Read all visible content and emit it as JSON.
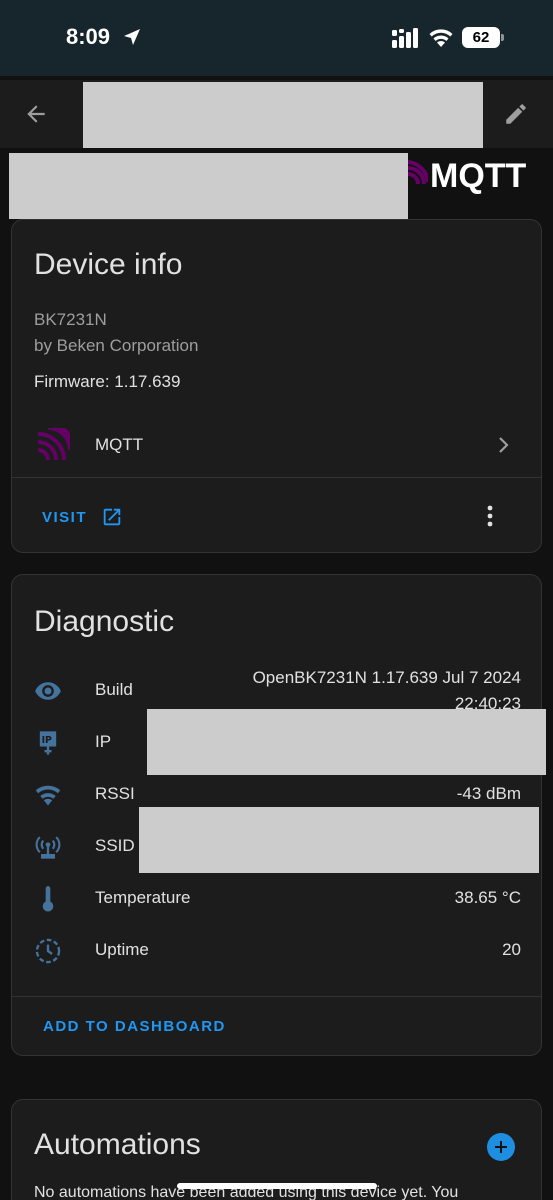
{
  "status_bar": {
    "time": "8:09",
    "battery_level": "62",
    "icons": [
      "location-arrow-icon",
      "cellular-signal-icon",
      "wifi-icon",
      "battery-icon"
    ]
  },
  "app_bar": {
    "icons": [
      "back-arrow-icon",
      "pencil-icon"
    ]
  },
  "banner": {
    "integration_logo_text": "MQTT",
    "colors": {
      "mqtt_purple": "#660066"
    }
  },
  "device_info": {
    "title": "Device info",
    "model": "BK7231N",
    "manufacturer": "by Beken Corporation",
    "firmware": "Firmware: 1.17.639",
    "integration_label": "MQTT",
    "visit_label": "VISIT",
    "icons": [
      "mqtt-icon",
      "chevron-right-icon",
      "open-in-new-icon",
      "dots-vertical-icon"
    ]
  },
  "diagnostic": {
    "title": "Diagnostic",
    "rows": [
      {
        "label": "Build",
        "value": "OpenBK7231N 1.17.639 Jul 7 2024 22:40:23",
        "icon": "eye-icon"
      },
      {
        "label": "IP",
        "value": "",
        "icon": "ip-network-icon"
      },
      {
        "label": "RSSI",
        "value": "-43 dBm",
        "icon": "wifi-icon"
      },
      {
        "label": "SSID",
        "value": "",
        "icon": "access-point-icon"
      },
      {
        "label": "Temperature",
        "value": "38.65 °C",
        "icon": "thermometer-icon"
      },
      {
        "label": "Uptime",
        "value": "20",
        "icon": "clock-outline-icon"
      }
    ],
    "add_to_dashboard_label": "ADD TO DASHBOARD"
  },
  "automations": {
    "title": "Automations",
    "empty_text": "No automations have been added using this device yet. You",
    "icons": [
      "plus-circle-icon"
    ]
  },
  "colors": {
    "accent": "#2196f3",
    "icon_blue": "#44739e",
    "card_bg": "#1c1c1c",
    "page_bg": "#111111"
  }
}
